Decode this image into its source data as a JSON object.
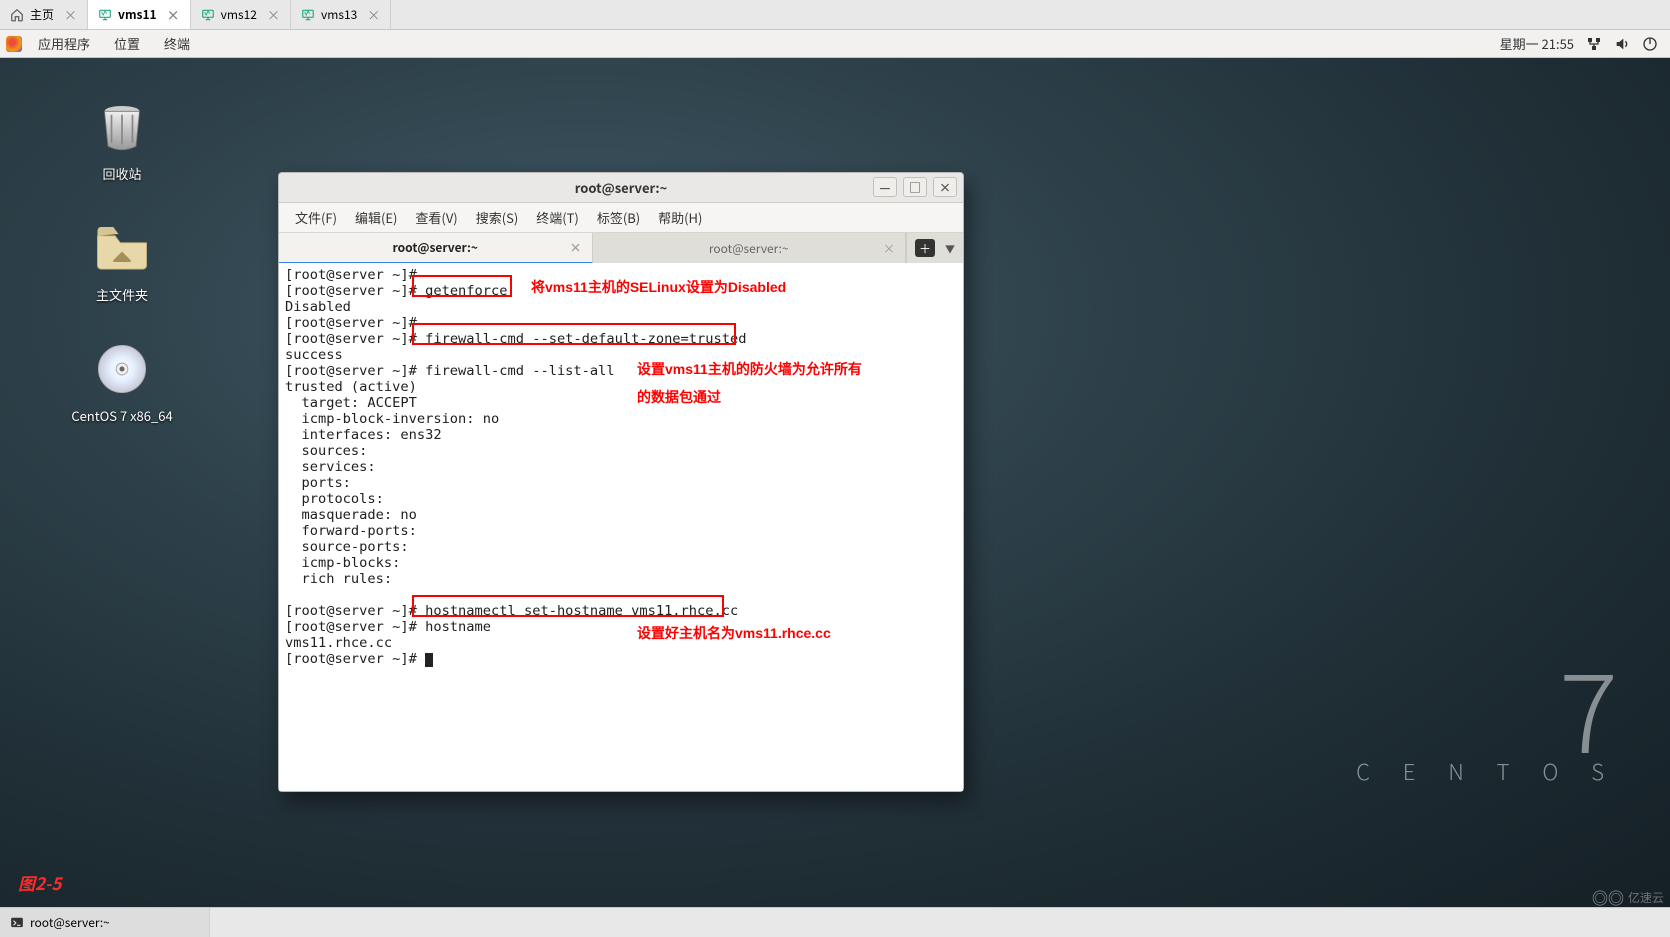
{
  "vmtabs": {
    "home": "主页",
    "items": [
      {
        "label": "vms11",
        "active": true
      },
      {
        "label": "vms12",
        "active": false
      },
      {
        "label": "vms13",
        "active": false
      }
    ]
  },
  "gnome": {
    "apps": "应用程序",
    "places": "位置",
    "terminal": "终端",
    "clock": "星期一 21:55"
  },
  "desktop": {
    "trash": "回收站",
    "home": "主文件夹",
    "dvd": "CentOS 7 x86_64"
  },
  "centos": {
    "seven": "7",
    "name": "C E N T O S"
  },
  "termwin": {
    "title": "root@server:~",
    "menus": {
      "file": "文件(F)",
      "edit": "编辑(E)",
      "view": "查看(V)",
      "search": "搜索(S)",
      "terminal": "终端(T)",
      "tabs": "标签(B)",
      "help": "帮助(H)"
    },
    "tabs": {
      "t1": "root@server:~",
      "t2": "root@server:~"
    }
  },
  "terminal": {
    "l01": "[root@server ~]#",
    "l02a": "[root@server ~]# ",
    "l02b": "getenforce ",
    "l03": "Disabled",
    "l04": "[root@server ~]#",
    "l05a": "[root@server ~]# ",
    "l05b": "firewall-cmd --set-default-zone=trusted ",
    "l06": "success",
    "l07": "[root@server ~]# firewall-cmd --list-all",
    "l08": "trusted (active)",
    "l09": "  target: ACCEPT",
    "l10": "  icmp-block-inversion: no",
    "l11": "  interfaces: ens32",
    "l12": "  sources:",
    "l13": "  services:",
    "l14": "  ports:",
    "l15": "  protocols:",
    "l16": "  masquerade: no",
    "l17": "  forward-ports:",
    "l18": "  source-ports:",
    "l19": "  icmp-blocks:",
    "l20": "  rich rules:",
    "l21": "",
    "l22a": "[root@server ~]# ",
    "l22b": "hostnamectl set-hostname vms11.rhce.cc ",
    "l23": "[root@server ~]# hostname",
    "l24": "vms11.rhce.cc",
    "l25": "[root@server ~]#"
  },
  "annotations": {
    "a1": "将vms11主机的SELinux设置为Disabled",
    "a2a": "设置vms11主机的防火墙为允许所有",
    "a2b": "的数据包通过",
    "a3": "设置好主机名为vms11.rhce.cc"
  },
  "figlabel": "图2-5",
  "taskbar": {
    "item": "root@server:~"
  },
  "watermark": "亿速云"
}
